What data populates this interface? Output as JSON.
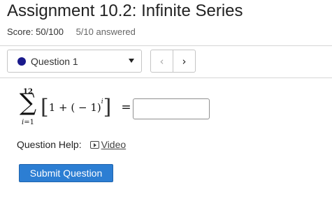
{
  "header": {
    "title": "Assignment 10.2: Infinite Series",
    "score": "Score: 50/100",
    "answered": "5/10 answered"
  },
  "question_nav": {
    "selected": "Question 1",
    "status_color": "#1a1a8c",
    "prev_icon": "chevron-left-icon",
    "next_icon": "chevron-right-icon",
    "prev_glyph": "‹",
    "next_glyph": "›"
  },
  "question": {
    "sum": {
      "upper": "12",
      "symbol": "∑",
      "lower_var": "i",
      "lower_eq": "=",
      "lower_val": "1"
    },
    "expression": {
      "open_bracket": "[",
      "body": "1 + ( − 1)",
      "exponent": "i",
      "close_bracket": "]",
      "equals": "="
    },
    "answer_value": ""
  },
  "help": {
    "label": "Question Help:",
    "video_label": "Video",
    "video_icon": "video-icon"
  },
  "actions": {
    "submit_label": "Submit Question",
    "submit_color": "#2c7ed3"
  }
}
